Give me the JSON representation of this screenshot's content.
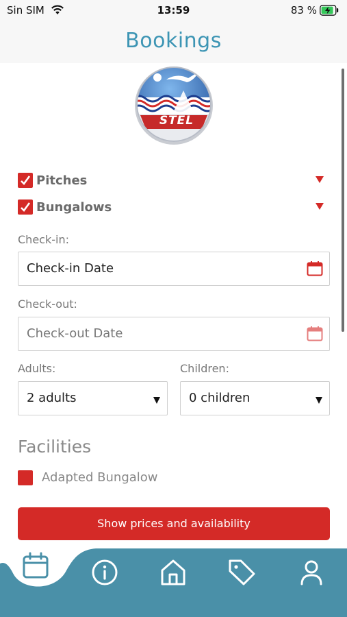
{
  "status_bar": {
    "carrier": "Sin SIM",
    "time": "13:59",
    "battery_percent": "83 %"
  },
  "header": {
    "title": "Bookings"
  },
  "logo": {
    "text": "STEL"
  },
  "accommodation_types": [
    {
      "label": "Pitches",
      "checked": true
    },
    {
      "label": "Bungalows",
      "checked": true
    }
  ],
  "checkin": {
    "label": "Check-in:",
    "value": "Check-in Date"
  },
  "checkout": {
    "label": "Check-out:",
    "placeholder": "Check-out Date"
  },
  "adults": {
    "label": "Adults:",
    "value": "2 adults"
  },
  "children": {
    "label": "Children:",
    "value": "0 children"
  },
  "facilities": {
    "title": "Facilities",
    "items": [
      {
        "label": "Adapted Bungalow",
        "checked": false
      }
    ]
  },
  "show_button": {
    "label": "Show prices and availability"
  },
  "tabbar": {
    "items": [
      {
        "name": "bookings",
        "icon": "calendar-icon",
        "active": true
      },
      {
        "name": "info",
        "icon": "info-icon"
      },
      {
        "name": "home",
        "icon": "home-icon"
      },
      {
        "name": "offers",
        "icon": "tag-icon"
      },
      {
        "name": "profile",
        "icon": "user-icon"
      }
    ]
  },
  "colors": {
    "accent_red": "#d42a27",
    "header_blue": "#3d95b4",
    "tabbar_teal": "#4a90a8"
  }
}
